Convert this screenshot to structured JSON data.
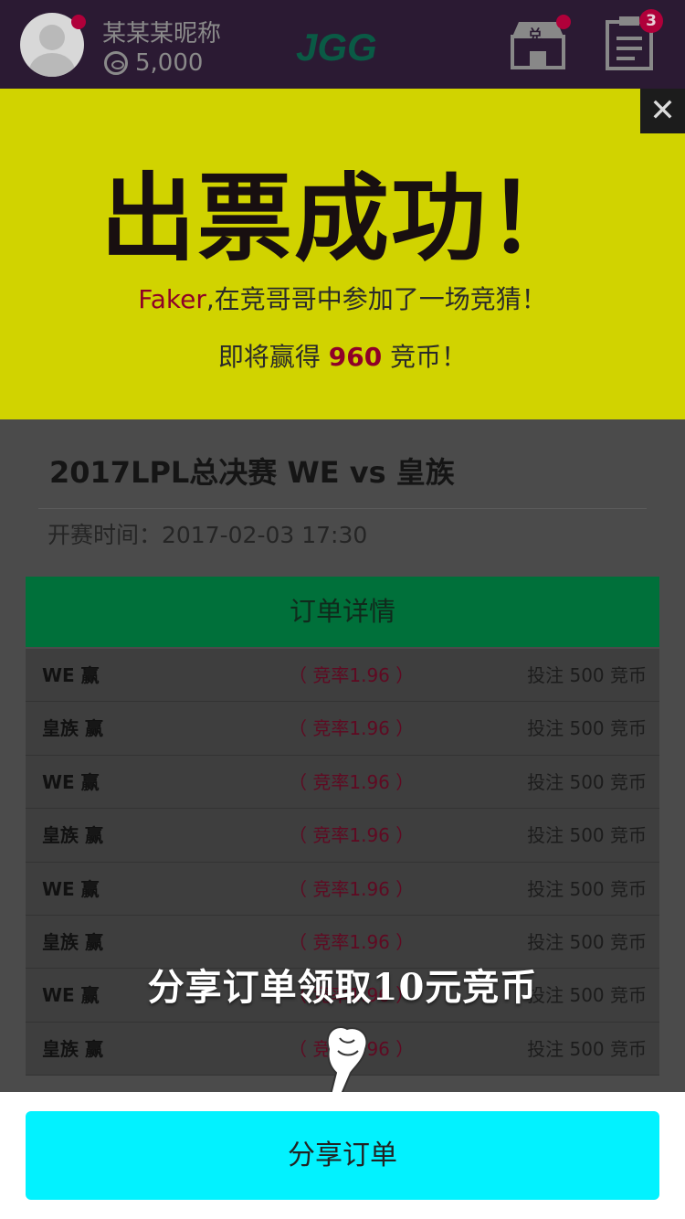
{
  "header": {
    "nickname": "某某某昵称",
    "coins": "5,000",
    "logo_text": "JGG",
    "exchange_label": "兑",
    "orders_badge": "3"
  },
  "banner": {
    "title": "出票成功！",
    "user": "Faker",
    "line1_rest": ",在竞哥哥中参加了一场竞猜！",
    "line2_prefix": "即将赢得 ",
    "win_amount": "960",
    "line2_suffix": " 竞币！",
    "close_label": "✕"
  },
  "match": {
    "title": "2017LPL总决赛 WE vs 皇族",
    "start_time": "开赛时间：2017-02-03  17:30"
  },
  "order": {
    "header": "订单详情",
    "rows": [
      {
        "team": "WE 赢",
        "odds": "（ 竞率1.96 ）",
        "bet": "投注 500 竞币"
      },
      {
        "team": "皇族 赢",
        "odds": "（ 竞率1.96 ）",
        "bet": "投注 500 竞币"
      },
      {
        "team": "WE 赢",
        "odds": "（ 竞率1.96 ）",
        "bet": "投注 500 竞币"
      },
      {
        "team": "皇族 赢",
        "odds": "（ 竞率1.96 ）",
        "bet": "投注 500 竞币"
      },
      {
        "team": "WE 赢",
        "odds": "（ 竞率1.96 ）",
        "bet": "投注 500 竞币"
      },
      {
        "team": "皇族 赢",
        "odds": "（ 竞率1.96 ）",
        "bet": "投注 500 竞币"
      },
      {
        "team": "WE 赢",
        "odds": "（ 竞率1.96 ）",
        "bet": "投注 500 竞币"
      },
      {
        "team": "皇族 赢",
        "odds": "（ 竞率1.96 ）",
        "bet": "投注 500 竞币"
      }
    ]
  },
  "promo": {
    "text": "分享订单领取10元竞币"
  },
  "footer": {
    "share_button": "分享订单"
  },
  "colors": {
    "banner_bg": "#d1d300",
    "order_header_bg": "#00703a",
    "share_button_bg": "#02f2ff",
    "accent_red": "#8e0028"
  }
}
